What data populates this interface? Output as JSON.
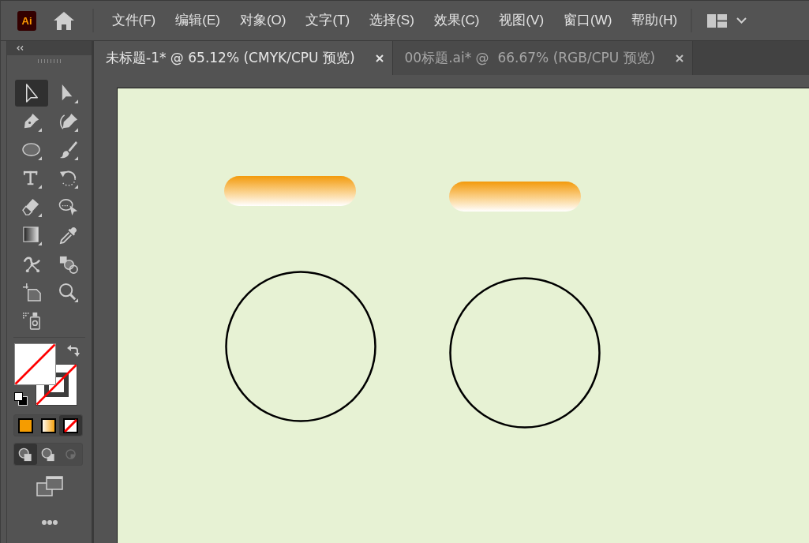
{
  "app": {
    "logo": "Ai"
  },
  "menu": [
    "文件(F)",
    "编辑(E)",
    "对象(O)",
    "文字(T)",
    "选择(S)",
    "效果(C)",
    "视图(V)",
    "窗口(W)",
    "帮助(H)"
  ],
  "tabs": [
    {
      "title": "未标题-1* @ 65.12% (CMYK/CPU 预览)",
      "selected": true
    },
    {
      "title": "00标题.ai* @  66.67% (RGB/CPU 预览)",
      "selected": false
    }
  ],
  "toolbar": {
    "tools": [
      {
        "kind": "selection",
        "selected": true
      },
      {
        "kind": "direct-selection",
        "selected": false
      },
      {
        "kind": "pen",
        "selected": false
      },
      {
        "kind": "curvature",
        "selected": false
      },
      {
        "kind": "ellipse",
        "selected": false
      },
      {
        "kind": "paintbrush",
        "selected": false
      },
      {
        "kind": "type",
        "selected": false
      },
      {
        "kind": "rotate",
        "selected": false
      },
      {
        "kind": "eraser",
        "selected": false
      },
      {
        "kind": "shape-builder",
        "selected": false
      },
      {
        "kind": "gradient",
        "selected": false
      },
      {
        "kind": "eyedropper",
        "selected": false
      },
      {
        "kind": "puppet-warp",
        "selected": false
      },
      {
        "kind": "shapes",
        "selected": false
      },
      {
        "kind": "artboard",
        "selected": false
      },
      {
        "kind": "zoom",
        "selected": false
      },
      {
        "kind": "symbol-sprayer",
        "selected": false
      }
    ],
    "fill": {
      "none": true
    },
    "stroke": {
      "none": true
    },
    "color_modes": [
      {
        "kind": "color",
        "selected": false
      },
      {
        "kind": "gradient",
        "selected": false
      },
      {
        "kind": "none",
        "selected": true
      }
    ],
    "draw_modes": [
      {
        "kind": "normal",
        "selected": true,
        "disabled": false
      },
      {
        "kind": "behind",
        "selected": false,
        "disabled": false
      },
      {
        "kind": "inside",
        "selected": false,
        "disabled": true
      }
    ]
  },
  "artboard": {
    "objects": [
      {
        "kind": "gradient-pill"
      },
      {
        "kind": "gradient-pill"
      },
      {
        "kind": "circle"
      },
      {
        "kind": "circle"
      }
    ]
  }
}
